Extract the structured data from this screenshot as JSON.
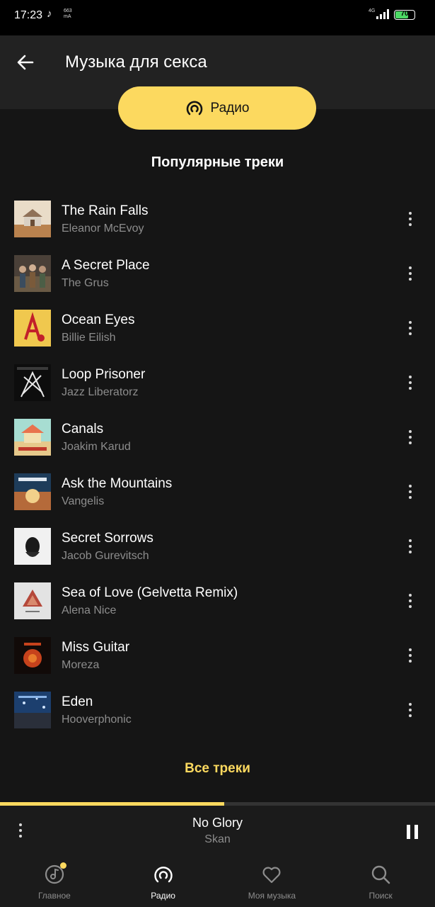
{
  "status_bar": {
    "time": "17:23",
    "speed": "663",
    "speed_unit": "mA",
    "network": "4G",
    "battery": "70",
    "battery_level": 0.7,
    "battery_color": "#4cd964"
  },
  "header": {
    "title": "Музыка для секса",
    "back_icon": "arrow-left-icon"
  },
  "radio_button": {
    "label": "Радио",
    "icon": "radio-wave-icon",
    "color": "#fcd95f"
  },
  "section_title": "Популярные треки",
  "tracks": [
    {
      "title": "The Rain Falls",
      "artist": "Eleanor McEvoy"
    },
    {
      "title": "A Secret Place",
      "artist": "The Grus"
    },
    {
      "title": "Ocean Eyes",
      "artist": "Billie Eilish"
    },
    {
      "title": "Loop Prisoner",
      "artist": "Jazz Liberatorz"
    },
    {
      "title": "Canals",
      "artist": "Joakim Karud"
    },
    {
      "title": "Ask the Mountains",
      "artist": "Vangelis"
    },
    {
      "title": "Secret Sorrows",
      "artist": "Jacob Gurevitsch"
    },
    {
      "title": "Sea of Love (Gelvetta Remix)",
      "artist": "Alena Nice"
    },
    {
      "title": "Miss Guitar",
      "artist": "Moreza"
    },
    {
      "title": "Eden",
      "artist": "Hooverphonic"
    }
  ],
  "all_tracks_label": "Все треки",
  "player": {
    "title": "No Glory",
    "artist": "Skan",
    "progress": 0.515,
    "state": "playing"
  },
  "nav": {
    "items": [
      {
        "label": "Главное",
        "icon": "home-music-icon"
      },
      {
        "label": "Радио",
        "icon": "radio-wave-icon",
        "active": true
      },
      {
        "label": "Моя музыка",
        "icon": "heart-icon"
      },
      {
        "label": "Поиск",
        "icon": "search-icon"
      }
    ]
  }
}
